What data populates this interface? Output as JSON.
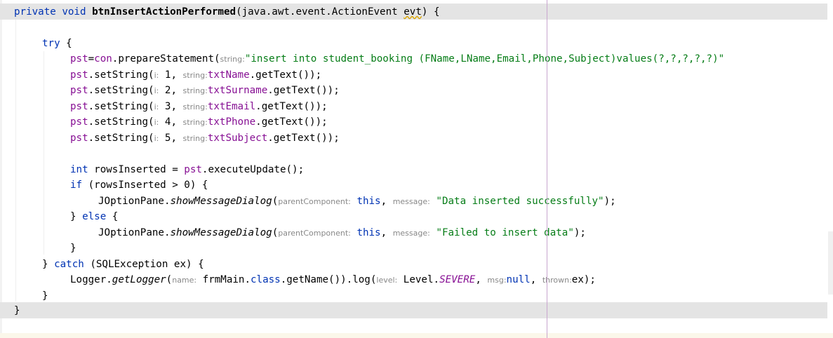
{
  "editor": {
    "lines": {
      "l1": {
        "kw_private": "private",
        "kw_void": "void",
        "method_name": "btnInsertActionPerformed",
        "sig_open": "(java.awt.event.ActionEvent ",
        "param": "evt",
        "sig_close": ") {"
      },
      "l2": {
        "kw_try": "try",
        "brace": " {"
      },
      "l3": {
        "field": "pst",
        "eq": "=",
        "con": "con",
        "call": ".prepareStatement(",
        "hint": "string:",
        "sql": "\"insert into student_booking (FName,LName,Email,Phone,Subject)values(?,?,?,?,?)\""
      },
      "set_rows": [
        {
          "field": "pst",
          "call": ".setString(",
          "hint_i": "i:",
          "idx": " 1, ",
          "hint_s": "string:",
          "txt": "txtName",
          "tail": ".getText());"
        },
        {
          "field": "pst",
          "call": ".setString(",
          "hint_i": "i:",
          "idx": " 2, ",
          "hint_s": "string:",
          "txt": "txtSurname",
          "tail": ".getText());"
        },
        {
          "field": "pst",
          "call": ".setString(",
          "hint_i": "i:",
          "idx": " 3, ",
          "hint_s": "string:",
          "txt": "txtEmail",
          "tail": ".getText());"
        },
        {
          "field": "pst",
          "call": ".setString(",
          "hint_i": "i:",
          "idx": " 4, ",
          "hint_s": "string:",
          "txt": "txtPhone",
          "tail": ".getText());"
        },
        {
          "field": "pst",
          "call": ".setString(",
          "hint_i": "i:",
          "idx": " 5, ",
          "hint_s": "string:",
          "txt": "txtSubject",
          "tail": ".getText());"
        }
      ],
      "l10": {
        "kw_int": "int",
        "var": " rowsInserted = ",
        "field": "pst",
        "call": ".executeUpdate();"
      },
      "l11": {
        "kw_if": "if",
        "cond": " (rowsInserted > 0) {"
      },
      "l12": {
        "cls": "JOptionPane.",
        "method": "showMessageDialog",
        "open": "(",
        "hint_parent": "parentComponent:",
        "this": "this",
        "comma": ", ",
        "hint_msg": "message:",
        "msg": "\"Data inserted successfully\"",
        "close": ");"
      },
      "l13": {
        "brace": "} ",
        "kw_else": "else",
        "open": " {"
      },
      "l14": {
        "cls": "JOptionPane.",
        "method": "showMessageDialog",
        "open": "(",
        "hint_parent": "parentComponent:",
        "this": "this",
        "comma": ", ",
        "hint_msg": "message:",
        "msg": "\"Failed to insert data\"",
        "close": ");"
      },
      "l15": {
        "brace": "}"
      },
      "l16": {
        "brace": "} ",
        "kw_catch": "catch",
        "rest": " (SQLException ex) {"
      },
      "l17": {
        "cls": "Logger.",
        "method": "getLogger",
        "open": "(",
        "hint_name": "name:",
        "frm": " frmMain.",
        "kw_class": "class",
        "mid": ".getName()).log(",
        "hint_level": "level:",
        "level": " Level.",
        "severe": "SEVERE",
        "comma1": ", ",
        "hint_msg": "msg:",
        "kw_null": "null",
        "comma2": ", ",
        "hint_thrown": "thrown:",
        "ex": "ex);"
      },
      "l18": {
        "brace": "}"
      },
      "l19": {
        "brace": "}"
      }
    }
  }
}
